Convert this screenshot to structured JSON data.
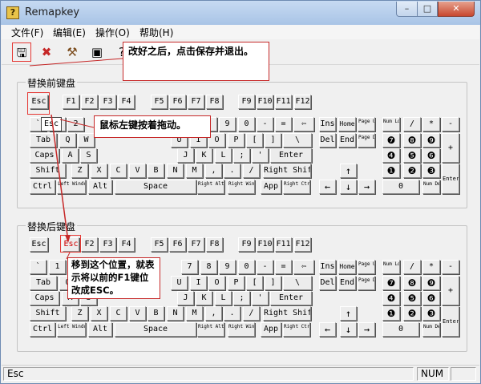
{
  "app": {
    "title": "Remapkey"
  },
  "window_controls": {
    "minimize": "–",
    "maximize": "□",
    "close": "✕"
  },
  "menu": [
    "文件(F)",
    "编辑(E)",
    "操作(O)",
    "帮助(H)"
  ],
  "toolbar": [
    "save-exit-icon",
    "undo-icon",
    "hammer-icon",
    "view-icon",
    "help-icon"
  ],
  "groups": {
    "base": "替换前键盘",
    "remapped": "替换后键盘"
  },
  "keys": {
    "esc": "Esc",
    "f1": "F1",
    "f2": "F2",
    "f3": "F3",
    "f4": "F4",
    "f5": "F5",
    "f6": "F6",
    "f7": "F7",
    "f8": "F8",
    "f9": "F9",
    "f10": "F10",
    "f11": "F11",
    "f12": "F12",
    "grave": "`",
    "one": "1",
    "two": "2",
    "seven": "7",
    "eight": "8",
    "nine": "9",
    "zero": "0",
    "minus": "-",
    "equal": "=",
    "backspace": "⇦",
    "tab": "Tab",
    "q": "Q",
    "w": "W",
    "u": "U",
    "i": "I",
    "o": "O",
    "p": "P",
    "lbracket": "[",
    "rbracket": "]",
    "backslash": "\\",
    "caps": "Caps",
    "a": "A",
    "s": "S",
    "j": "J",
    "k": "K",
    "l": "L",
    "semicolon": ";",
    "quote": "'",
    "enter": "Enter",
    "shift": "Shift",
    "z": "Z",
    "x": "X",
    "c": "C",
    "v": "V",
    "b": "B",
    "n": "N",
    "m": "M",
    "comma": ",",
    "period": ".",
    "slash": "/",
    "rshift": "Right Shift",
    "ctrl": "Ctrl",
    "lwin": "Left Windows",
    "alt": "Alt",
    "space": "Space",
    "ralt": "Right Alt",
    "rwin": "Right Windows",
    "app": "App",
    "rctrl": "Right Ctrl",
    "ins": "Ins",
    "home": "Home",
    "pgup": "Page Up",
    "del": "Del",
    "end": "End",
    "pgdn": "Page Down",
    "up": "↑",
    "left": "←",
    "down": "↓",
    "right": "→",
    "numlock": "Num Lock",
    "ndiv": "/",
    "nmul": "*",
    "nsub": "-",
    "n7": "❼",
    "n8": "❽",
    "n9": "❾",
    "nadd": "+",
    "n4": "❹",
    "n5": "❺",
    "n6": "❻",
    "n1": "❶",
    "n2": "❷",
    "n3": "❸",
    "nenter": "Enter",
    "n0": "0",
    "ndel": "Num Del"
  },
  "callouts": {
    "save": "改好之后，点击保存并退出。",
    "drag": "鼠标左键按着拖动。",
    "drop": "移到这个位置，就表示将以前的F1键位改成ESC。"
  },
  "drag_ghost": "Esc",
  "status": {
    "left": "Esc",
    "num": "NUM"
  }
}
